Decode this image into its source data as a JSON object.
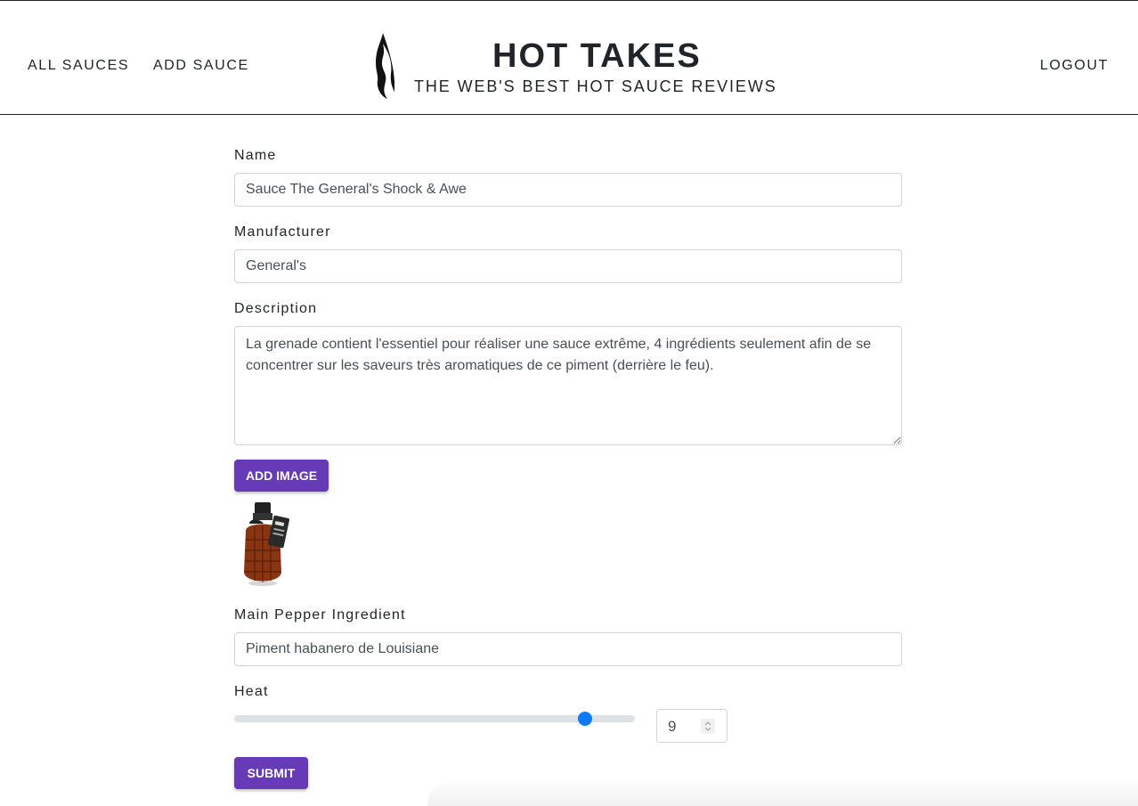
{
  "nav": {
    "all_sauces": "ALL SAUCES",
    "add_sauce": "ADD SAUCE",
    "logout": "LOGOUT"
  },
  "brand": {
    "title": "HOT TAKES",
    "subtitle": "THE WEB'S BEST HOT SAUCE REVIEWS",
    "logo_icon": "flame-icon"
  },
  "form": {
    "name_label": "Name",
    "name_value": "Sauce The General's Shock & Awe",
    "manufacturer_label": "Manufacturer",
    "manufacturer_value": "General's",
    "description_label": "Description",
    "description_value": "La grenade contient l'essentiel pour réaliser une sauce extrême, 4 ingrédients seulement afin de se concentrer sur les saveurs très aromatiques de ce piment (derrière le feu).",
    "add_image_label": "ADD IMAGE",
    "pepper_label": "Main Pepper Ingredient",
    "pepper_value": "Piment habanero de Louisiane",
    "heat_label": "Heat",
    "heat_value": "9",
    "heat_min": 1,
    "heat_max": 10,
    "submit_label": "SUBMIT"
  },
  "colors": {
    "button": "#673ab7",
    "slider_thumb": "#0d7bff"
  }
}
